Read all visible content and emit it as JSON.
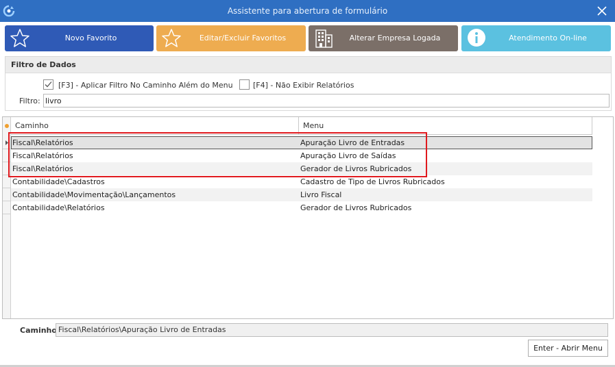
{
  "window": {
    "title": "Assistente para abertura de formulário"
  },
  "toolbar": {
    "buttons": [
      {
        "label": "Novo Favorito",
        "color": "#2f5ab6",
        "icon": "star-outline-icon"
      },
      {
        "label": "Editar/Excluir Favoritos",
        "color": "#eeac50",
        "icon": "star-outline-icon"
      },
      {
        "label": "Alterar Empresa Logada",
        "color": "#7b6f68",
        "icon": "building-icon"
      },
      {
        "label": "Atendimento On-line",
        "color": "#5bc1e0",
        "icon": "info-icon"
      }
    ]
  },
  "filter_panel": {
    "title": "Filtro de Dados",
    "option_f3": {
      "label": "[F3] - Aplicar Filtro No Caminho Além do Menu",
      "checked": true
    },
    "option_f4": {
      "label": "[F4] - Não Exibir Relatórios",
      "checked": false
    },
    "filter_label": "Filtro:",
    "filter_value": "livro"
  },
  "grid": {
    "columns": [
      "Caminho",
      "Menu"
    ],
    "rows": [
      {
        "path": "Fiscal\\Relatórios",
        "menu": "Apuração Livro de Entradas",
        "selected": true
      },
      {
        "path": "Fiscal\\Relatórios",
        "menu": "Apuração Livro de Saídas",
        "selected": false
      },
      {
        "path": "Fiscal\\Relatórios",
        "menu": "Gerador de Livros Rubricados",
        "selected": false
      },
      {
        "path": "Contabilidade\\Cadastros",
        "menu": "Cadastro de Tipo de Livros Rubricados",
        "selected": false
      },
      {
        "path": "Contabilidade\\Movimentação\\Lançamentos",
        "menu": "Livro Fiscal",
        "selected": false
      },
      {
        "path": "Contabilidade\\Relatórios",
        "menu": "Gerador de Livros Rubricados",
        "selected": false
      }
    ]
  },
  "footer": {
    "path_label": "Caminho:",
    "path_value": "Fiscal\\Relatórios\\Apuração Livro de Entradas",
    "open_button": "Enter - Abrir Menu"
  },
  "colors": {
    "titlebar": "#2f6fc2",
    "highlight": "#e0191e"
  }
}
